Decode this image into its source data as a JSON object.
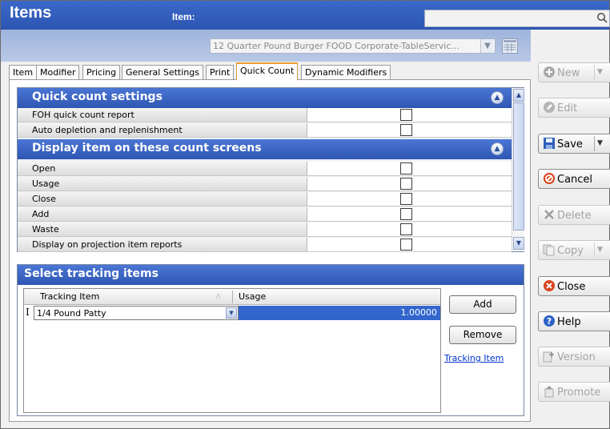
{
  "window": {
    "title": "Items"
  },
  "search": {
    "placeholder": ""
  },
  "item_selector": {
    "label": "Item:",
    "value": "12 Quarter Pound Burger FOOD Corporate-TableServic..."
  },
  "tabs": [
    {
      "label": "Item"
    },
    {
      "label": "Modifier"
    },
    {
      "label": "Pricing"
    },
    {
      "label": "General Settings"
    },
    {
      "label": "Print"
    },
    {
      "label": "Quick Count",
      "active": true
    },
    {
      "label": "Dynamic Modifiers"
    }
  ],
  "quick_count": {
    "title": "Quick count settings",
    "rows": [
      {
        "label": "FOH quick count report",
        "checked": false
      },
      {
        "label": "Auto depletion and replenishment",
        "checked": false
      }
    ]
  },
  "count_screens": {
    "title": "Display item on these count screens",
    "rows": [
      {
        "label": "Open",
        "checked": false
      },
      {
        "label": "Usage",
        "checked": false
      },
      {
        "label": "Close",
        "checked": false
      },
      {
        "label": "Add",
        "checked": false
      },
      {
        "label": "Waste",
        "checked": false
      },
      {
        "label": "Display on projection item reports",
        "checked": false
      }
    ]
  },
  "tracking": {
    "title": "Select tracking items",
    "columns": [
      "Tracking Item",
      "Usage"
    ],
    "rows": [
      {
        "marker": "I",
        "item": "1/4 Pound Patty",
        "usage": "1.00000"
      }
    ],
    "add_label": "Add",
    "remove_label": "Remove",
    "link_label": "Tracking Item"
  },
  "commands": [
    {
      "label": "New",
      "enabled": false,
      "dropdown": true,
      "icon": "plus-icon"
    },
    {
      "label": "Edit",
      "enabled": false,
      "dropdown": false,
      "icon": "pencil-icon"
    },
    {
      "label": "Save",
      "enabled": true,
      "dropdown": true,
      "icon": "floppy-icon"
    },
    {
      "label": "Cancel",
      "enabled": true,
      "dropdown": false,
      "icon": "cancel-icon"
    },
    {
      "label": "Delete",
      "enabled": false,
      "dropdown": false,
      "icon": "x-icon"
    },
    {
      "label": "Copy",
      "enabled": false,
      "dropdown": true,
      "icon": "copy-icon"
    },
    {
      "label": "Close",
      "enabled": true,
      "dropdown": false,
      "icon": "close-icon"
    },
    {
      "label": "Help",
      "enabled": true,
      "dropdown": false,
      "icon": "help-icon"
    },
    {
      "label": "Version",
      "enabled": false,
      "dropdown": false,
      "icon": "version-icon"
    },
    {
      "label": "Promote",
      "enabled": false,
      "dropdown": false,
      "icon": "promote-icon"
    }
  ],
  "colors": {
    "title_bar": "#2c55b0",
    "section_header": "#3a62c2",
    "selected_cell": "#3366cc",
    "active_tab_accent": "#f0a030"
  }
}
